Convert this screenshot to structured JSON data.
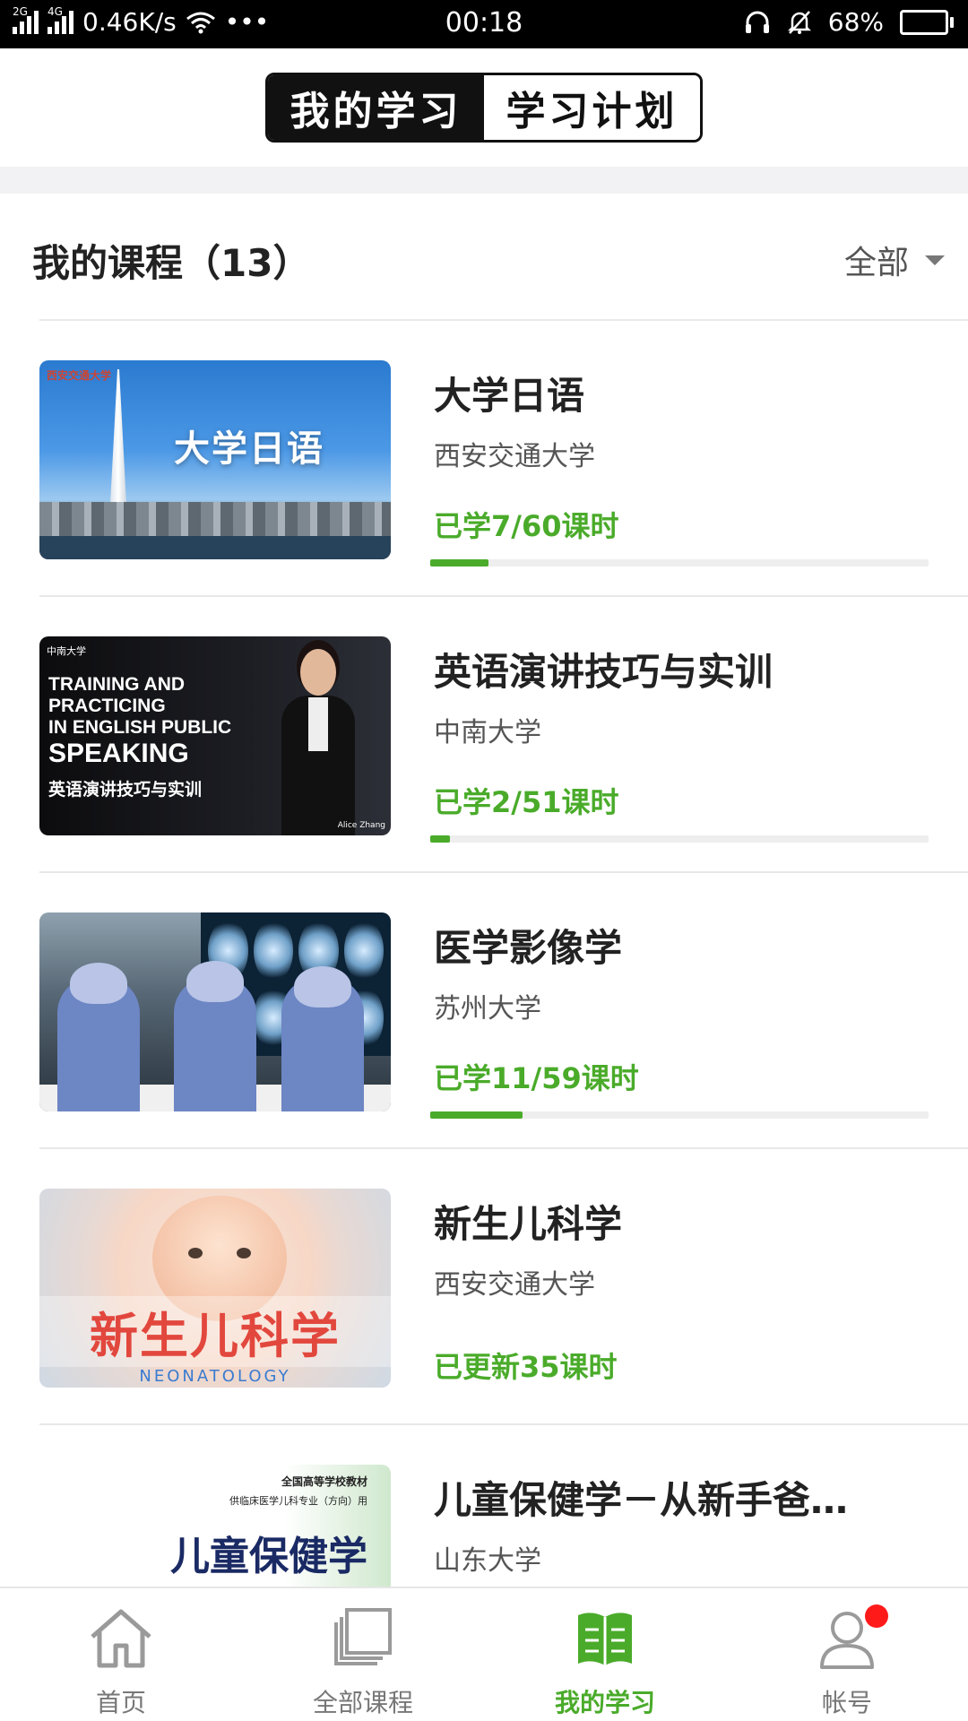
{
  "status_bar": {
    "net1": "2G",
    "net2": "4G",
    "speed": "0.46K/s",
    "dots": "•••",
    "time": "00:18",
    "battery": "68%",
    "battery_level": 0.68
  },
  "header": {
    "tabs": [
      {
        "label": "我的学习",
        "active": true
      },
      {
        "label": "学习计划",
        "active": false
      }
    ]
  },
  "section": {
    "title": "我的课程（13）",
    "filter_label": "全部"
  },
  "courses": [
    {
      "title": "大学日语",
      "school": "西安交通大学",
      "progress_text": "已学7/60课时",
      "progress": 0.117,
      "thumb_text": "大学日语",
      "thumb_logo": "西安交通大学"
    },
    {
      "title": "英语演讲技巧与实训",
      "school": "中南大学",
      "progress_text": "已学2/51课时",
      "progress": 0.039,
      "thumb_lines": [
        "TRAINING AND",
        "PRACTICING",
        "IN ENGLISH PUBLIC",
        "SPEAKING"
      ],
      "thumb_cn": "英语演讲技巧与实训",
      "thumb_logo": "中南大学",
      "thumb_badge": "Alice Zhang"
    },
    {
      "title": "医学影像学",
      "school": "苏州大学",
      "progress_text": "已学11/59课时",
      "progress": 0.186
    },
    {
      "title": "新生儿科学",
      "school": "西安交通大学",
      "progress_text": "已更新35课时",
      "thumb_cn": "新生儿科学",
      "thumb_en": "NEONATOLOGY"
    },
    {
      "title": "儿童保健学－从新手爸…",
      "school": "山东大学",
      "thumb_line1": "全国高等学校教材",
      "thumb_line2": "供临床医学儿科专业（方向）用",
      "thumb_title": "儿童保健学"
    }
  ],
  "tabbar": {
    "items": [
      {
        "label": "首页",
        "icon": "home-icon",
        "active": false
      },
      {
        "label": "全部课程",
        "icon": "courses-icon",
        "active": false
      },
      {
        "label": "我的学习",
        "icon": "book-icon",
        "active": true
      },
      {
        "label": "帐号",
        "icon": "user-icon",
        "active": false
      }
    ]
  },
  "colors": {
    "accent": "#4aab2a",
    "header_active_bg": "#111111",
    "badge_dot": "#ff1a1a"
  }
}
